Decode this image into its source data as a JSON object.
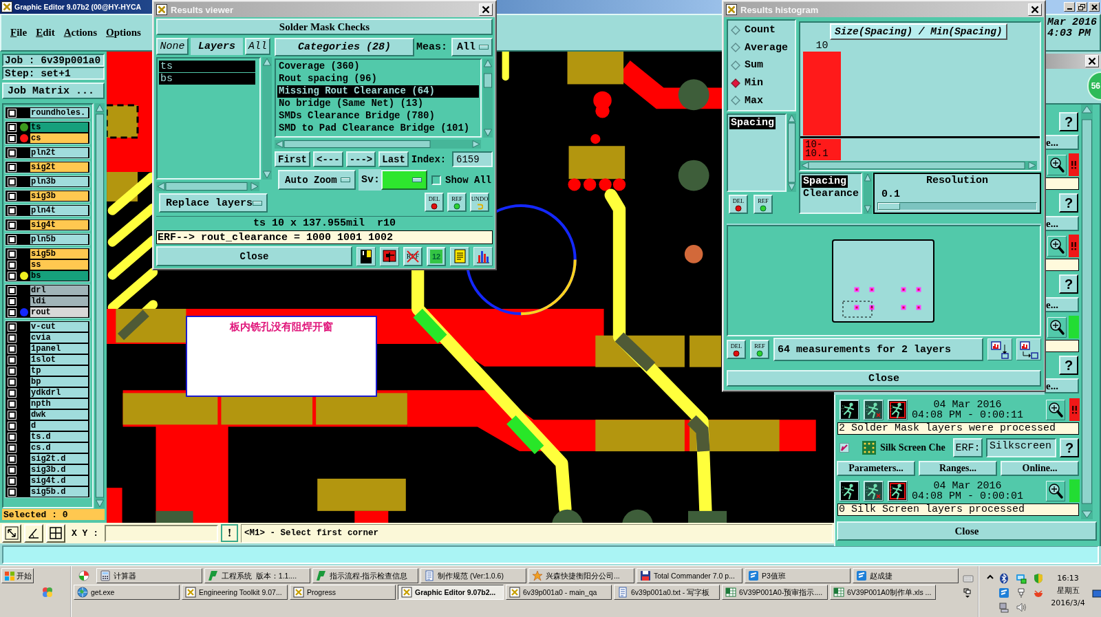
{
  "main_window": {
    "title": "Graphic Editor 9.07b2 (00@HY-HYCA",
    "menu": [
      "File",
      "Edit",
      "Actions",
      "Options"
    ],
    "clock": [
      "Mar 2016",
      "4:03 PM"
    ],
    "canvas_note": "板内铣孔没有阻焊开窗",
    "toolbar": {
      "xy_label": "X Y :",
      "alert_button": "!",
      "prompt": "<M1> - Select first corner"
    }
  },
  "job_panel": {
    "job": "Job : 6v39p001a0",
    "step": "Step: set+1",
    "matrix_button": "Job Matrix ...",
    "layer_groups": [
      [
        {
          "name": "roundholes.",
          "color": "#a0dcdc",
          "checked": false
        }
      ],
      [
        {
          "name": "ts",
          "color": "#16a07c",
          "dot": {
            "color": "#3c9a1e"
          },
          "checked": false
        },
        {
          "name": "cs",
          "color": "#ffc850",
          "dot": {
            "color": "#ff1414"
          },
          "checked": false
        }
      ],
      [
        {
          "name": "pln2t",
          "color": "#a0dcdc",
          "checked": false
        }
      ],
      [
        {
          "name": "sig2t",
          "color": "#ffc850",
          "checked": false
        }
      ],
      [
        {
          "name": "pln3b",
          "color": "#a0dcdc",
          "checked": false
        }
      ],
      [
        {
          "name": "sig3b",
          "color": "#ffc850",
          "checked": false
        }
      ],
      [
        {
          "name": "pln4t",
          "color": "#a0dcdc",
          "checked": false
        }
      ],
      [
        {
          "name": "sig4t",
          "color": "#ffc850",
          "checked": false
        }
      ],
      [
        {
          "name": "pln5b",
          "color": "#a0dcdc",
          "checked": false
        }
      ],
      [
        {
          "name": "sig5b",
          "color": "#ffc850",
          "checked": false
        },
        {
          "name": "ss",
          "color": "#ffc850",
          "checked": false
        },
        {
          "name": "bs",
          "color": "#16a07c",
          "dot": {
            "color": "#f0f020"
          },
          "checked": false
        }
      ],
      [
        {
          "name": "drl",
          "color": "#a0b4b8",
          "checked": false
        },
        {
          "name": "ldi",
          "color": "#a0b4b8",
          "checked": false
        },
        {
          "name": "rout",
          "color": "#d8d8d8",
          "dot": {
            "color": "#1428ff"
          },
          "checked": false
        }
      ],
      [
        {
          "name": "v-cut",
          "color": "#a0dcdc",
          "checked": false
        },
        {
          "name": "cvia",
          "color": "#a0dcdc",
          "checked": false
        },
        {
          "name": "1panel",
          "color": "#a0dcdc",
          "checked": false
        },
        {
          "name": "1slot",
          "color": "#a0dcdc",
          "checked": false
        },
        {
          "name": "tp",
          "color": "#a0dcdc",
          "checked": false
        },
        {
          "name": "bp",
          "color": "#a0dcdc",
          "checked": false
        },
        {
          "name": "ydkdrl",
          "color": "#a0dcdc",
          "checked": false
        },
        {
          "name": "npth",
          "color": "#a0dcdc",
          "checked": false
        },
        {
          "name": "dwk",
          "color": "#a0dcdc",
          "checked": false
        },
        {
          "name": "d",
          "color": "#a0dcdc",
          "checked": false
        },
        {
          "name": "ts.d",
          "color": "#a0dcdc",
          "checked": false
        },
        {
          "name": "cs.d",
          "color": "#a0dcdc",
          "checked": false
        },
        {
          "name": "sig2t.d",
          "color": "#a0dcdc",
          "checked": false
        },
        {
          "name": "sig3b.d",
          "color": "#a0dcdc",
          "checked": false
        },
        {
          "name": "sig4t.d",
          "color": "#a0dcdc",
          "checked": false
        },
        {
          "name": "sig5b.d",
          "color": "#a0dcdc",
          "checked": false
        }
      ]
    ],
    "selected": "Selected : 0"
  },
  "results_viewer": {
    "title": "Results viewer",
    "header": "Solder Mask Checks",
    "layer_filter": {
      "none": "None",
      "title": "Layers",
      "all": "All"
    },
    "layers": [
      {
        "name": "ts",
        "selected": true
      },
      {
        "name": "bs",
        "selected": true
      }
    ],
    "replace_mode": "Replace layers",
    "categories_button": "Categories (28)",
    "meas_label": "Meas:",
    "meas_value": "All",
    "categories": [
      {
        "label": "Coverage (360)",
        "selected": false
      },
      {
        "label": "Rout spacing (96)",
        "selected": false
      },
      {
        "label": "Missing Rout Clearance (64)",
        "selected": true
      },
      {
        "label": "No bridge (Same Net) (13)",
        "selected": false
      },
      {
        "label": "SMDs Clearance Bridge (780)",
        "selected": false
      },
      {
        "label": "SMD to Pad Clearance Bridge (101)",
        "selected": false
      }
    ],
    "nav_buttons": [
      "First",
      "<---",
      "--->",
      "Last"
    ],
    "index_label": "Index:",
    "index_value": "6159",
    "zoom_mode": "Auto Zoom",
    "sv": {
      "label": "Sv:",
      "color": "#2ee62e"
    },
    "show_all": {
      "label": "Show All",
      "checked": false
    },
    "actions": [
      {
        "kind": "del",
        "label": "DEL"
      },
      {
        "kind": "ref",
        "label": "REF"
      },
      {
        "kind": "undo",
        "label": "UNDO"
      }
    ],
    "measurement": "ts 10 x 137.955mil  r10",
    "erf_line": "ERF--> rout_clearance = 1000 1001 1002",
    "close": "Close",
    "tool_buttons": [
      {
        "kind": "figure"
      },
      {
        "kind": "marker"
      },
      {
        "kind": "ref_off",
        "label": "REF"
      },
      {
        "kind": "pages",
        "label": "12"
      },
      {
        "kind": "notes"
      },
      {
        "kind": "chart"
      }
    ]
  },
  "results_histogram": {
    "title": "Results histogram",
    "modes": [
      {
        "label": "Count",
        "selected": false
      },
      {
        "label": "Average",
        "selected": false
      },
      {
        "label": "Sum",
        "selected": false
      },
      {
        "label": "Min",
        "selected": true
      },
      {
        "label": "Max",
        "selected": false
      }
    ],
    "measures": [
      {
        "label": "Spacing",
        "selected": true
      }
    ],
    "side_actions": [
      {
        "kind": "del",
        "label": "DEL"
      },
      {
        "kind": "ref",
        "label": "REF"
      }
    ],
    "histogram": {
      "title": "Size(Spacing) / Min(Spacing)",
      "bars": [
        {
          "label": "10",
          "bin": "10-10.1"
        }
      ]
    },
    "measure_types": [
      {
        "label": "Spacing",
        "selected": true
      },
      {
        "label": "Clearance",
        "selected": false
      }
    ],
    "resolution": {
      "label": "Resolution",
      "value": "0.1",
      "level": 0
    },
    "bottom_actions": [
      {
        "kind": "del",
        "label": "DEL"
      },
      {
        "kind": "ref",
        "label": "REF"
      }
    ],
    "summary": "64 measurements for 2 layers",
    "close": "Close"
  },
  "checks_window": {
    "badge": "56",
    "checks": [
      {
        "help": "?",
        "tail": "e...",
        "passed": false
      },
      {
        "help": "?",
        "tail": "e...",
        "passed": false
      },
      {
        "help": "?",
        "tail": "e...",
        "passed": true
      },
      {
        "help": "?",
        "tail": "e...",
        "passed": false,
        "date": "04 Mar 2016",
        "time": "04:08 PM - 0:00:11",
        "message": "2 Solder Mask layers were processed"
      },
      {
        "checked": true,
        "name": "Silk Screen Che",
        "erf_label": "ERF:",
        "erf_value": "Silkscreen",
        "help": "?",
        "buttons": [
          "Parameters...",
          "Ranges...",
          "Online..."
        ],
        "passed": true,
        "date": "04 Mar 2016",
        "time": "04:08 PM - 0:00:01",
        "message": "0 Silk Screen layers processed"
      }
    ],
    "close": "Close"
  },
  "taskbar": {
    "start": "开始",
    "rows": [
      [
        {
          "label": "计算器",
          "selected": false
        },
        {
          "label": "工程系统  版本：1.1....",
          "selected": false
        },
        {
          "label": "指示流程-指示检查信息",
          "selected": false
        },
        {
          "label": "制作规范 (Ver:1.0.6)",
          "selected": false
        },
        {
          "label": "兴森快捷衡阳分公司...",
          "selected": false
        },
        {
          "label": "Total Commander 7.0 p...",
          "selected": false
        },
        {
          "label": "P3值班",
          "selected": false
        },
        {
          "label": "赵成捷",
          "selected": false
        }
      ],
      [
        {
          "label": "get.exe",
          "selected": false
        },
        {
          "label": "Engineering Toolkit 9.07...",
          "selected": false
        },
        {
          "label": "Progress",
          "selected": false
        },
        {
          "label": "Graphic Editor 9.07b2...",
          "selected": true
        },
        {
          "label": "6v39p001a0 - main_qa",
          "selected": false
        },
        {
          "label": "6v39p001a0.txt - 写字板",
          "selected": false
        },
        {
          "label": "6V39P001A0-预审指示....",
          "selected": false
        },
        {
          "label": "6V39P001A0制作单.xls ...",
          "selected": false
        }
      ]
    ],
    "clock": [
      "16:13",
      "星期五",
      "2016/3/4"
    ]
  }
}
